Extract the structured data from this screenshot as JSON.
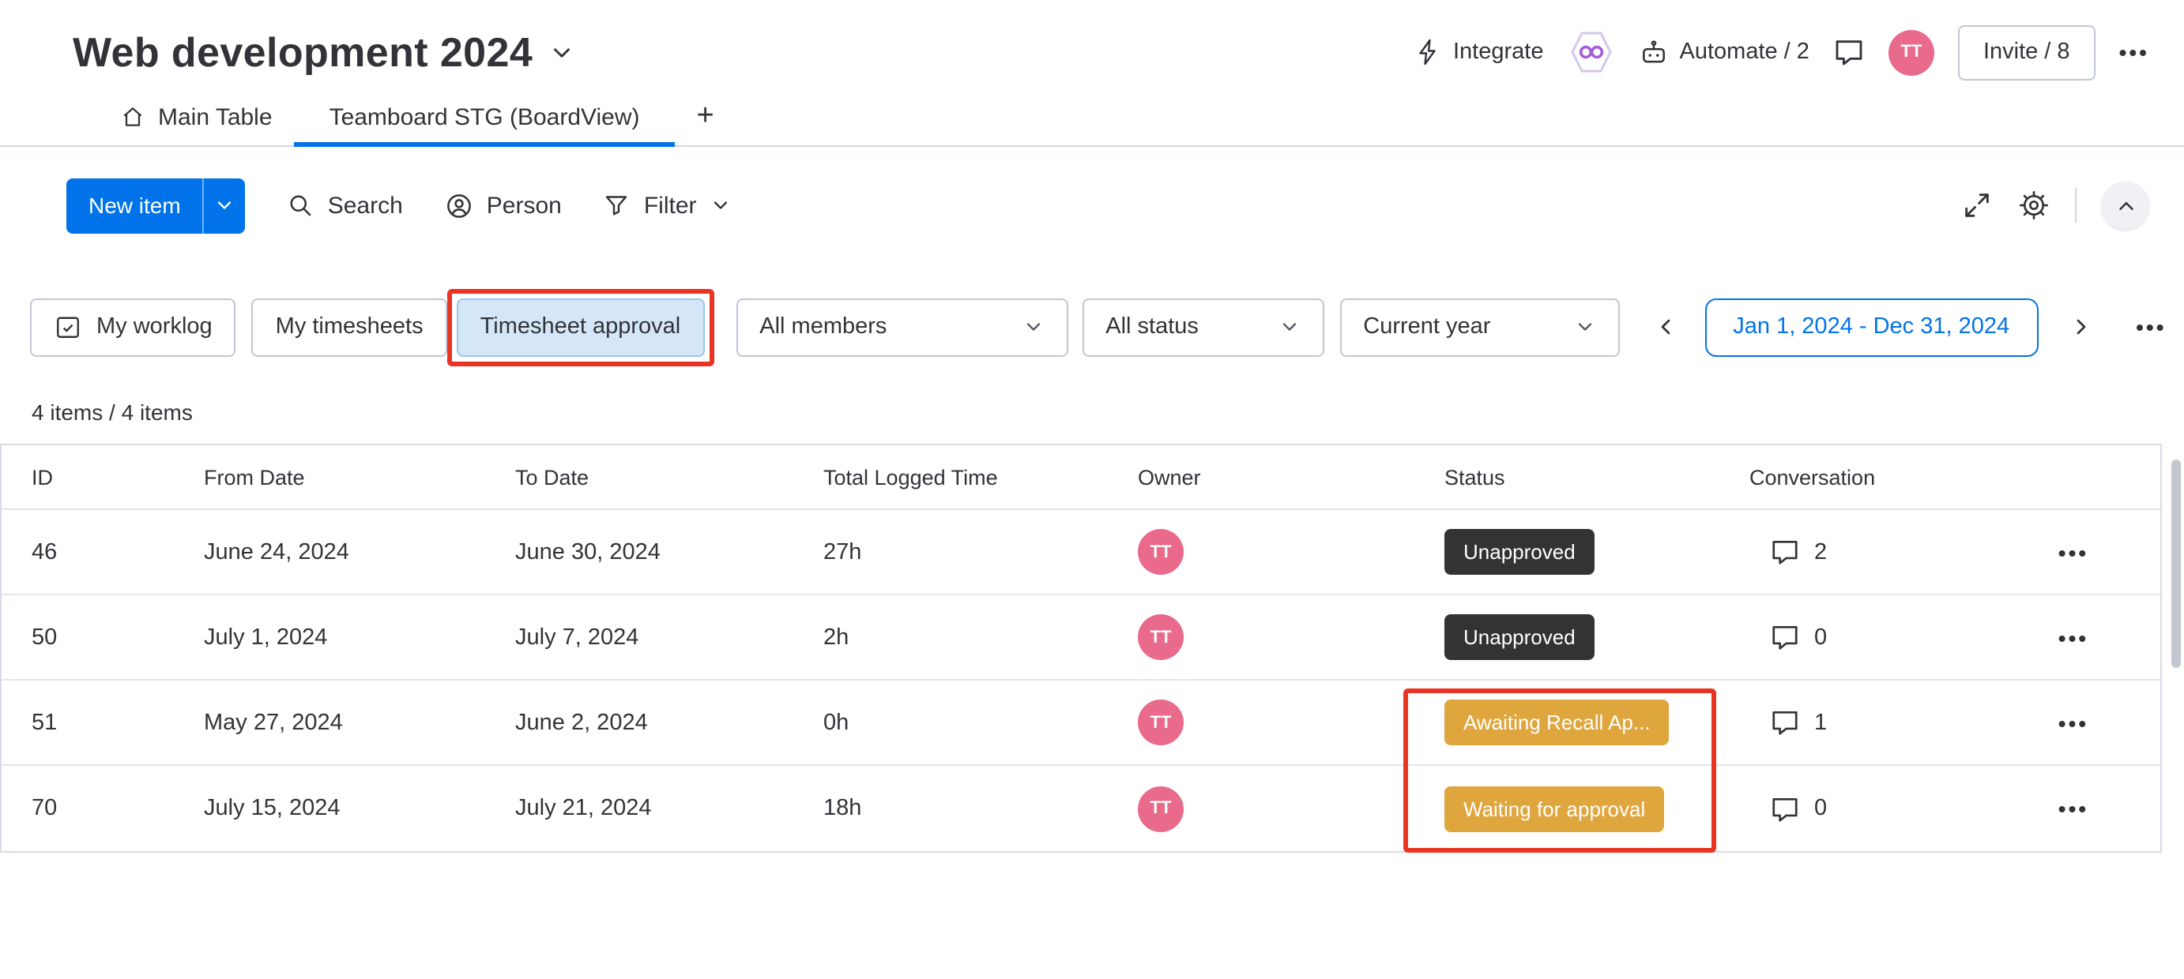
{
  "header": {
    "board_title": "Web development 2024",
    "integrate_label": "Integrate",
    "automate_label": "Automate / 2",
    "invite_label": "Invite / 8",
    "avatar_initials": "TT"
  },
  "tabs": {
    "main_table": "Main Table",
    "board_view": "Teamboard STG (BoardView)",
    "add_tab": "+"
  },
  "toolbar": {
    "new_item": "New item",
    "search": "Search",
    "person": "Person",
    "filter": "Filter"
  },
  "filters": {
    "my_worklog": "My worklog",
    "my_timesheets": "My timesheets",
    "timesheet_approval": "Timesheet approval",
    "all_members": "All members",
    "all_status": "All status",
    "current_year": "Current year",
    "date_range": "Jan 1, 2024 - Dec 31, 2024"
  },
  "summary": {
    "items_count": "4 items / 4 items"
  },
  "table": {
    "columns": [
      "ID",
      "From Date",
      "To Date",
      "Total Logged Time",
      "Owner",
      "Status",
      "Conversation"
    ],
    "rows": [
      {
        "id": "46",
        "from": "June 24, 2024",
        "to": "June 30, 2024",
        "total": "27h",
        "owner": "TT",
        "status": "Unapproved",
        "status_type": "dark",
        "conversations": "2"
      },
      {
        "id": "50",
        "from": "July 1, 2024",
        "to": "July 7, 2024",
        "total": "2h",
        "owner": "TT",
        "status": "Unapproved",
        "status_type": "dark",
        "conversations": "0"
      },
      {
        "id": "51",
        "from": "May 27, 2024",
        "to": "June 2, 2024",
        "total": "0h",
        "owner": "TT",
        "status": "Awaiting Recall Ap...",
        "status_type": "gold",
        "conversations": "1"
      },
      {
        "id": "70",
        "from": "July 15, 2024",
        "to": "July 21, 2024",
        "total": "18h",
        "owner": "TT",
        "status": "Waiting for approval",
        "status_type": "gold",
        "conversations": "0"
      }
    ]
  },
  "icons": {
    "ellipsis": "•••"
  },
  "colors": {
    "accent": "#0073ea",
    "status_dark": "#333333",
    "status_gold": "#e0a63e",
    "avatar_pink": "#e96a8b",
    "annotation_red": "#ea3423",
    "chip_selected_bg": "#d5e6f8",
    "chip_selected_border": "#9fc3ea"
  }
}
